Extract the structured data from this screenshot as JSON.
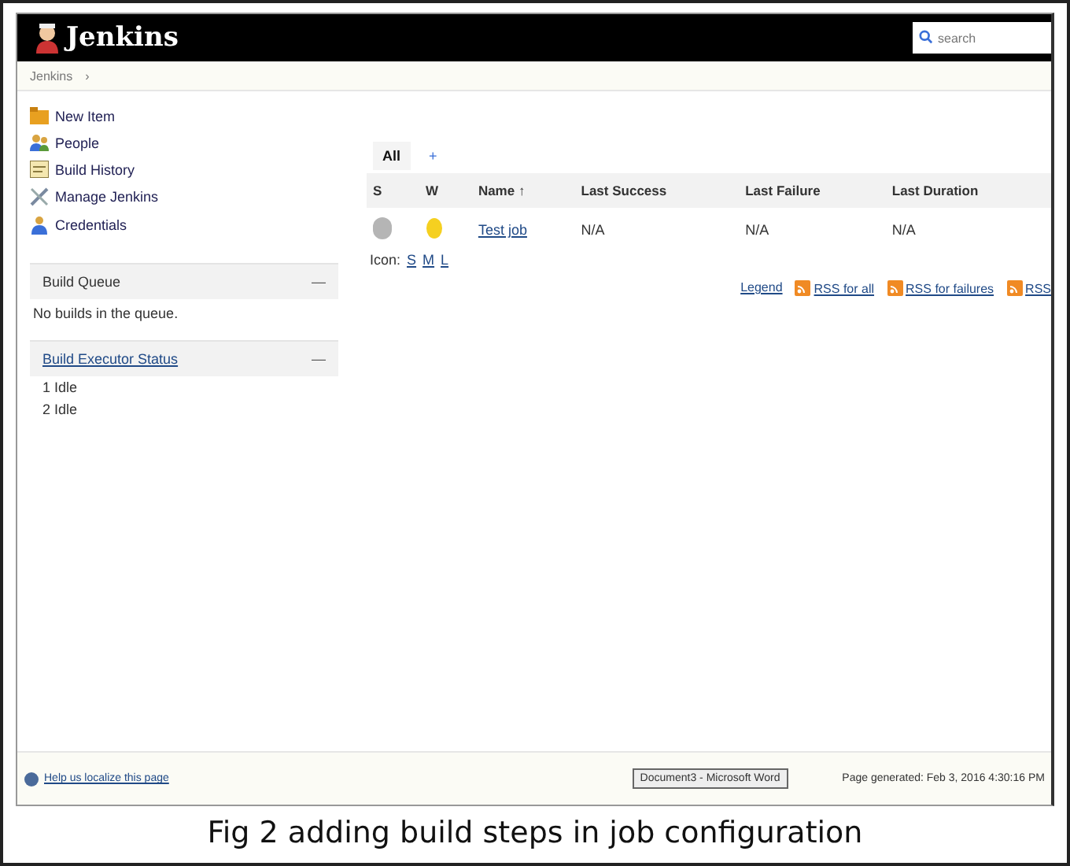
{
  "header": {
    "title": "Jenkins",
    "search": {
      "placeholder": "search"
    }
  },
  "breadcrumb": [
    "Jenkins",
    "›"
  ],
  "sidebar": {
    "items": [
      {
        "label": "New Item"
      },
      {
        "label": "People"
      },
      {
        "label": "Build History"
      },
      {
        "label": "Manage Jenkins"
      },
      {
        "label": "Credentials"
      }
    ],
    "panels": [
      {
        "title": "Build Queue",
        "link": false,
        "toggle": "—",
        "lines": [
          "No builds in the queue."
        ]
      },
      {
        "title": "Build Executor Status",
        "link": true,
        "toggle": "—",
        "lines": [
          "1  Idle",
          "2  Idle"
        ]
      }
    ]
  },
  "view_tabs": [
    {
      "label": "All",
      "selected": true
    },
    {
      "label": "+",
      "selected": false
    }
  ],
  "table": {
    "columns": [
      "S",
      "W",
      "Name ↑",
      "Last Success",
      "Last Failure",
      "Last Duration"
    ],
    "rows": [
      {
        "name": "Test job",
        "last_success": "N/A",
        "last_failure": "N/A",
        "last_duration": "N/A"
      }
    ]
  },
  "icon_sizes": {
    "label": "Icon:",
    "sizes": [
      "S",
      "M",
      "L"
    ]
  },
  "feeds": {
    "legend": "Legend",
    "links": [
      "RSS for all",
      "RSS for failures",
      "RSS"
    ]
  },
  "footer": {
    "link": "Help us localize this page",
    "taskbar_tooltip": "Document3 - Microsoft Word",
    "generated": "Page generated: Feb 3, 2016 4:30:16 PM"
  },
  "caption": "Fig 2 adding build steps in job configuration"
}
